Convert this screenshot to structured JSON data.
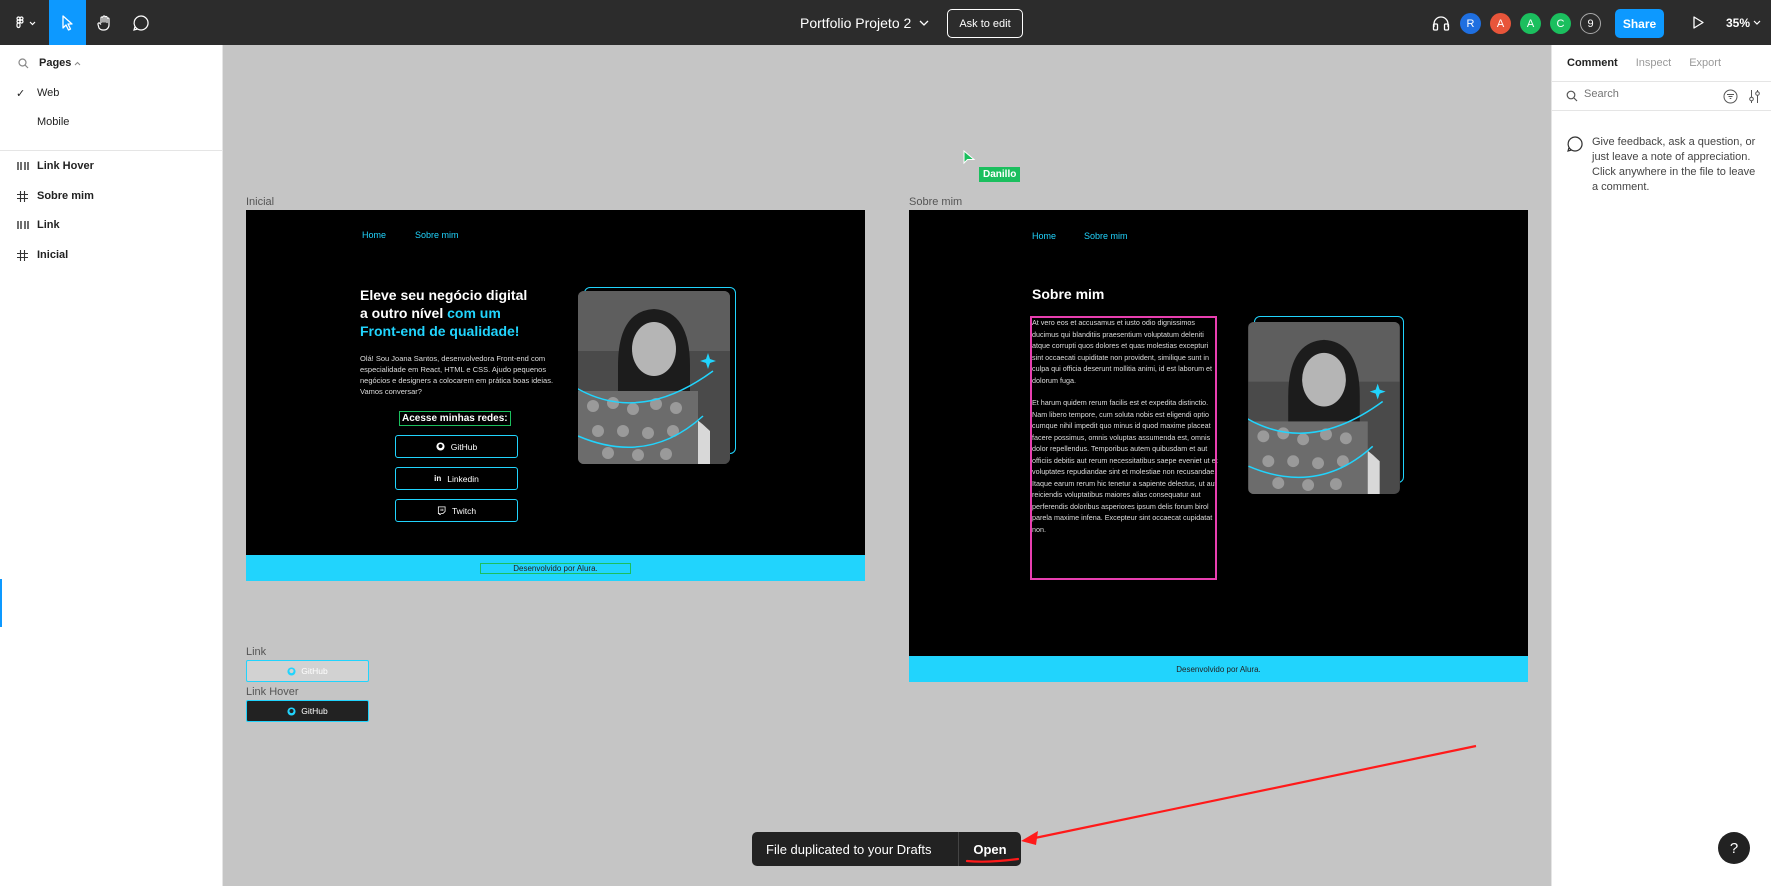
{
  "toolbar": {
    "file_title": "Portfolio Projeto 2",
    "ask_to_edit": "Ask to edit",
    "avatars": [
      {
        "letter": "R",
        "color": "#1f6fe0"
      },
      {
        "letter": "A",
        "color": "#e8553a"
      },
      {
        "letter": "A",
        "color": "#1bbf5e"
      },
      {
        "letter": "C",
        "color": "#1bbf5e"
      }
    ],
    "more_count": "9",
    "share": "Share",
    "zoom": "35%"
  },
  "left": {
    "pages_label": "Pages",
    "pages": [
      {
        "label": "Web",
        "checked": true
      },
      {
        "label": "Mobile",
        "checked": false
      }
    ],
    "layers": [
      {
        "label": "Link Hover",
        "icon": "component-icon"
      },
      {
        "label": "Sobre mim",
        "icon": "frame-icon"
      },
      {
        "label": "Link",
        "icon": "component-icon"
      },
      {
        "label": "Inicial",
        "icon": "frame-icon"
      }
    ]
  },
  "right": {
    "tabs": [
      "Comment",
      "Inspect",
      "Export"
    ],
    "active_tab": "Comment",
    "search_placeholder": "Search",
    "help_text": "Give feedback, ask a question, or just leave a note of appreciation. Click anywhere in the file to leave a comment."
  },
  "canvas": {
    "cursor_user": "Danillo",
    "inicial": {
      "label": "Inicial",
      "nav": [
        "Home",
        "Sobre mim"
      ],
      "headline_1": "Eleve seu negócio digital",
      "headline_2": "a outro nível ",
      "headline_highlight_1": "com um",
      "headline_highlight_2": "Front-end de qualidade!",
      "intro": "Olá! Sou Joana Santos, desenvolvedora Front-end com especialidade em React, HTML e CSS. Ajudo pequenos negócios e designers a colocarem em prática boas ideias. Vamos conversar?",
      "redes": "Acesse minhas redes:",
      "buttons": [
        "GitHub",
        "Linkedin",
        "Twitch"
      ],
      "footer": "Desenvolvido por Alura."
    },
    "sobre": {
      "label": "Sobre mim",
      "nav": [
        "Home",
        "Sobre mim"
      ],
      "title": "Sobre mim",
      "para1": "At vero eos et accusamus et iusto odio dignissimos ducimus qui blanditiis praesentium voluptatum deleniti atque corrupti quos dolores et quas molestias excepturi sint occaecati cupiditate non provident, similique sunt in culpa qui officia deserunt mollitia animi, id est laborum et dolorum fuga.",
      "para2": "Et harum quidem rerum facilis est et expedita distinctio. Nam libero tempore, cum soluta nobis est eligendi optio cumque nihil impedit quo minus id quod maxime placeat facere possimus, omnis voluptas assumenda est, omnis dolor repellendus. Temporibus autem quibusdam et aut officiis debitis aut rerum necessitatibus saepe eveniet ut et voluptates repudiandae sint et molestiae non recusandae. Itaque earum rerum hic tenetur a sapiente delectus, ut aut reiciendis voluptatibus maiores alias consequatur aut perferendis doloribus asperiores ipsum delis forum birol parela maxime infena. Excepteur sint occaecat cupidatat non.",
      "footer": "Desenvolvido por Alura."
    },
    "components": [
      {
        "label": "Link",
        "button": "GitHub"
      },
      {
        "label": "Link Hover",
        "button": "GitHub"
      }
    ]
  },
  "toast": {
    "message": "File duplicated to your Drafts",
    "action": "Open"
  },
  "help_button": "?"
}
